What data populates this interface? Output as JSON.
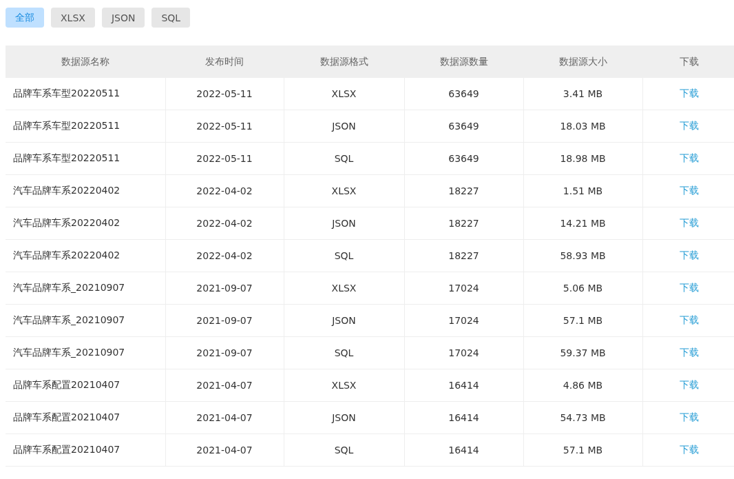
{
  "filters": [
    {
      "label": "全部",
      "selected": true
    },
    {
      "label": "XLSX",
      "selected": false
    },
    {
      "label": "JSON",
      "selected": false
    },
    {
      "label": "SQL",
      "selected": false
    }
  ],
  "table": {
    "columns": [
      "数据源名称",
      "发布时间",
      "数据源格式",
      "数据源数量",
      "数据源大小",
      "下载"
    ],
    "rows": [
      {
        "name": "品牌车系车型20220511",
        "date": "2022-05-11",
        "format": "XLSX",
        "count": "63649",
        "size": "3.41 MB",
        "download": "下载"
      },
      {
        "name": "品牌车系车型20220511",
        "date": "2022-05-11",
        "format": "JSON",
        "count": "63649",
        "size": "18.03 MB",
        "download": "下载"
      },
      {
        "name": "品牌车系车型20220511",
        "date": "2022-05-11",
        "format": "SQL",
        "count": "63649",
        "size": "18.98 MB",
        "download": "下载"
      },
      {
        "name": "汽车品牌车系20220402",
        "date": "2022-04-02",
        "format": "XLSX",
        "count": "18227",
        "size": "1.51 MB",
        "download": "下载"
      },
      {
        "name": "汽车品牌车系20220402",
        "date": "2022-04-02",
        "format": "JSON",
        "count": "18227",
        "size": "14.21 MB",
        "download": "下载"
      },
      {
        "name": "汽车品牌车系20220402",
        "date": "2022-04-02",
        "format": "SQL",
        "count": "18227",
        "size": "58.93 MB",
        "download": "下载"
      },
      {
        "name": "汽车品牌车系_20210907",
        "date": "2021-09-07",
        "format": "XLSX",
        "count": "17024",
        "size": "5.06 MB",
        "download": "下载"
      },
      {
        "name": "汽车品牌车系_20210907",
        "date": "2021-09-07",
        "format": "JSON",
        "count": "17024",
        "size": "57.1 MB",
        "download": "下载"
      },
      {
        "name": "汽车品牌车系_20210907",
        "date": "2021-09-07",
        "format": "SQL",
        "count": "17024",
        "size": "59.37 MB",
        "download": "下载"
      },
      {
        "name": "品牌车系配置20210407",
        "date": "2021-04-07",
        "format": "XLSX",
        "count": "16414",
        "size": "4.86 MB",
        "download": "下载"
      },
      {
        "name": "品牌车系配置20210407",
        "date": "2021-04-07",
        "format": "JSON",
        "count": "16414",
        "size": "54.73 MB",
        "download": "下载"
      },
      {
        "name": "品牌车系配置20210407",
        "date": "2021-04-07",
        "format": "SQL",
        "count": "16414",
        "size": "57.1 MB",
        "download": "下载"
      }
    ]
  }
}
